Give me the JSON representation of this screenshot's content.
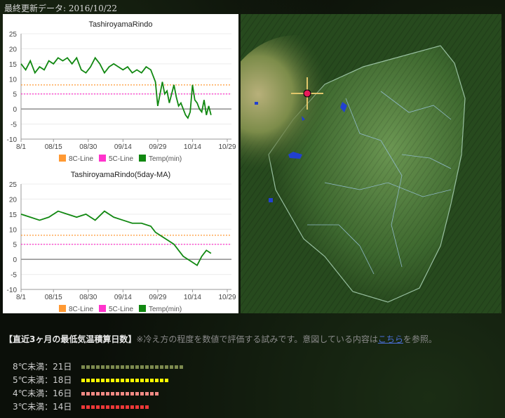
{
  "header": {
    "last_updated": "最終更新データ: 2016/10/22"
  },
  "chart_data": [
    {
      "type": "line",
      "title": "TashiroyamaRindo",
      "x_ticks": [
        "8/1",
        "08/15",
        "08/30",
        "09/14",
        "09/29",
        "10/14",
        "10/29"
      ],
      "x": [
        "8/1",
        "8/3",
        "8/5",
        "8/7",
        "8/9",
        "8/11",
        "8/13",
        "8/15",
        "8/17",
        "8/19",
        "8/21",
        "8/23",
        "8/25",
        "8/27",
        "8/29",
        "8/31",
        "9/2",
        "9/4",
        "9/6",
        "9/8",
        "9/10",
        "9/12",
        "9/14",
        "9/16",
        "9/18",
        "9/20",
        "9/22",
        "9/24",
        "9/26",
        "9/28",
        "9/29",
        "9/30",
        "10/1",
        "10/2",
        "10/3",
        "10/4",
        "10/5",
        "10/6",
        "10/7",
        "10/8",
        "10/9",
        "10/10",
        "10/11",
        "10/12",
        "10/13",
        "10/14",
        "10/15",
        "10/16",
        "10/17",
        "10/18",
        "10/19",
        "10/20",
        "10/21",
        "10/22"
      ],
      "y_ticks": [
        -10,
        -5,
        0,
        5,
        10,
        15,
        20,
        25
      ],
      "ylim": [
        -10,
        25
      ],
      "series": [
        {
          "name": "8C-Line",
          "color": "#ff9933",
          "values_const": 8
        },
        {
          "name": "5C-Line",
          "color": "#ff33cc",
          "values_const": 5
        },
        {
          "name": "Temp(min)",
          "color": "#118811",
          "values": [
            15,
            13,
            16,
            12,
            14,
            13,
            16,
            15,
            17,
            16,
            17,
            15,
            17,
            13,
            12,
            14,
            17,
            15,
            12,
            14,
            15,
            14,
            13,
            14,
            12,
            13,
            12,
            14,
            13,
            9,
            1,
            5,
            9,
            5,
            6,
            2,
            5,
            8,
            4,
            1,
            2,
            0,
            -2,
            -3,
            -1,
            8,
            3,
            2,
            0,
            -1,
            3,
            -2,
            1,
            -2
          ]
        }
      ]
    },
    {
      "type": "line",
      "title": "TashiroyamaRindo(5day-MA)",
      "x_ticks": [
        "8/1",
        "08/15",
        "08/30",
        "09/14",
        "09/29",
        "10/14",
        "10/29"
      ],
      "x": [
        "8/1",
        "8/5",
        "8/9",
        "8/13",
        "8/17",
        "8/21",
        "8/25",
        "8/29",
        "9/2",
        "9/6",
        "9/10",
        "9/14",
        "9/18",
        "9/22",
        "9/26",
        "9/28",
        "9/30",
        "10/2",
        "10/4",
        "10/6",
        "10/8",
        "10/10",
        "10/12",
        "10/14",
        "10/16",
        "10/18",
        "10/20",
        "10/22"
      ],
      "y_ticks": [
        -10,
        -5,
        0,
        5,
        10,
        15,
        20,
        25
      ],
      "ylim": [
        -10,
        25
      ],
      "series": [
        {
          "name": "8C-Line",
          "color": "#ff9933",
          "values_const": 8
        },
        {
          "name": "5C-Line",
          "color": "#ff33cc",
          "values_const": 5
        },
        {
          "name": "Temp(min)",
          "color": "#118811",
          "values": [
            15,
            14,
            13,
            14,
            16,
            15,
            14,
            15,
            13,
            16,
            14,
            13,
            12,
            12,
            11,
            9,
            8,
            7,
            6,
            5,
            3,
            1,
            0,
            -1,
            -2,
            1,
            3,
            2
          ]
        }
      ]
    }
  ],
  "info": {
    "heading": "【直近3ヶ月の最低気温積算日数】",
    "note_before": "※冷え方の程度を数値で評価する試みです。意図している内容は",
    "link": "こちら",
    "note_after": "を参照。"
  },
  "stats": [
    {
      "label": "8℃未満：21日",
      "days": 21,
      "color": "#7d8a4e"
    },
    {
      "label": "5℃未満：18日",
      "days": 18,
      "color": "#ffff00"
    },
    {
      "label": "4℃未満：16日",
      "days": 16,
      "color": "#f08a84"
    },
    {
      "label": "3℃未満：14日",
      "days": 14,
      "color": "#ee3838"
    }
  ]
}
